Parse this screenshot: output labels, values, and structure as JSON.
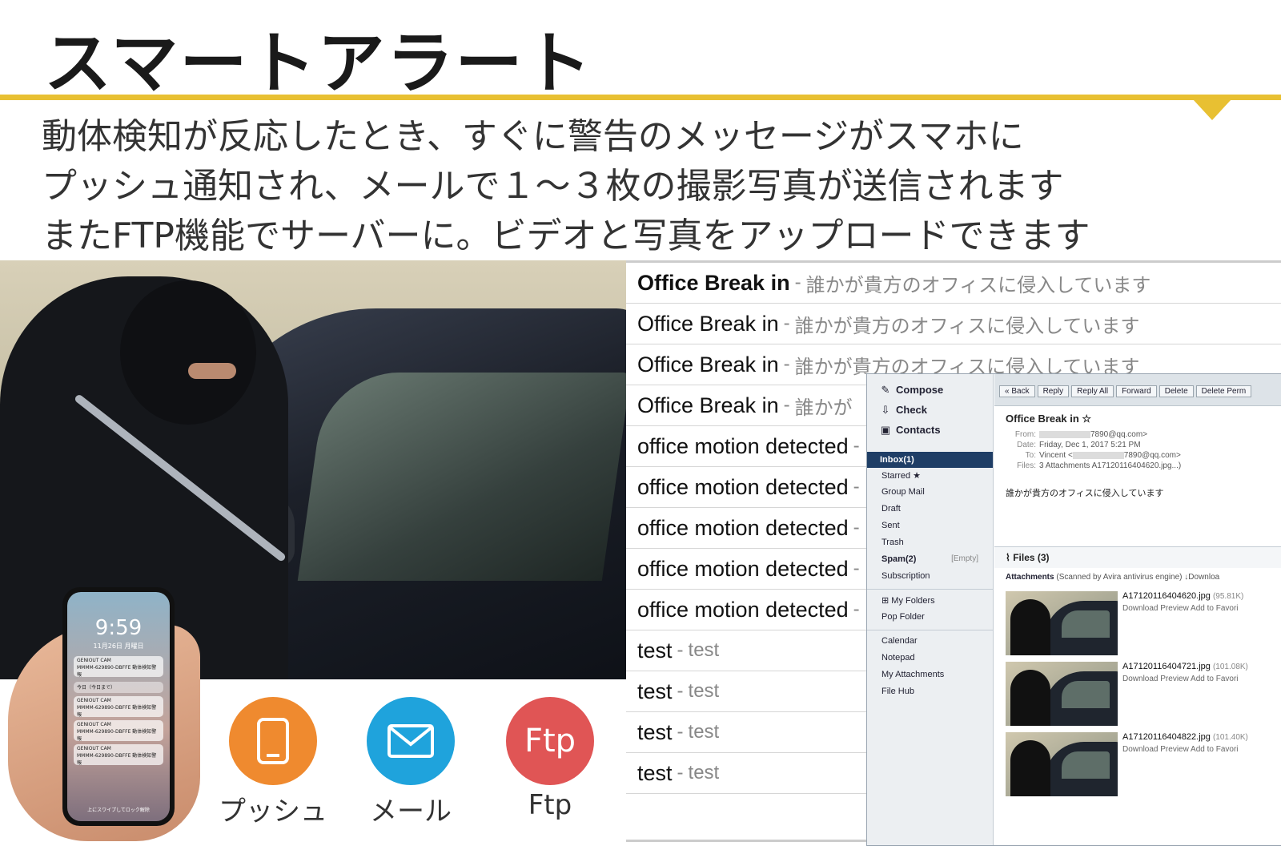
{
  "header": {
    "title": "スマートアラート",
    "subtitle_lines": [
      "動体検知が反応したとき、すぐに警告のメッセージがスマホに",
      "プッシュ通知され、メールで１～３枚の撮影写真が送信されます",
      "またFTP機能でサーバーに。ビデオと写真をアップロードできます"
    ]
  },
  "phone": {
    "time": "9:59",
    "date": "11月26日 月曜日",
    "notifications": [
      {
        "app": "GENIOUT CAM",
        "text": "MMMM-629890-DBFFE 動体検知警報"
      },
      {
        "app": "今日（今日まで）",
        "text": ""
      },
      {
        "app": "GENIOUT CAM",
        "text": "MMMM-629890-DBFFE 動体検知警報"
      },
      {
        "app": "GENIOUT CAM",
        "text": "MMMM-629890-DBFFE 動体検知警報"
      },
      {
        "app": "GENIOUT CAM",
        "text": "MMMM-629890-DBFFE 動体検知警報"
      }
    ],
    "unlock_hint": "上にスワイプしてロック解除"
  },
  "features": [
    {
      "label": "プッシュ",
      "icon": "tablet-icon",
      "color": "#ef8a2f"
    },
    {
      "label": "メール",
      "icon": "envelope-icon",
      "color": "#1fa3dc"
    },
    {
      "label": "Ftp",
      "icon_text": "Ftp",
      "icon": "ftp-icon",
      "color": "#e05555"
    }
  ],
  "mail_list": [
    {
      "subject": "Office Break in",
      "preview": "誰かが貴方のオフィスに侵入しています",
      "bold": true
    },
    {
      "subject": "Office Break in",
      "preview": "誰かが貴方のオフィスに侵入しています",
      "bold": false
    },
    {
      "subject": "Office Break in",
      "preview": "誰かが貴方のオフィスに侵入しています",
      "bold": false
    },
    {
      "subject": "Office Break in",
      "preview": "誰かが",
      "bold": false
    },
    {
      "subject": "office motion detected",
      "preview": "",
      "bold": false
    },
    {
      "subject": "office motion detected",
      "preview": "",
      "bold": false
    },
    {
      "subject": "office motion detected",
      "preview": "",
      "bold": false
    },
    {
      "subject": "office motion detected",
      "preview": "",
      "bold": false
    },
    {
      "subject": "office motion detected",
      "preview": "",
      "bold": false
    },
    {
      "subject": "test",
      "preview": "test",
      "bold": false
    },
    {
      "subject": "test",
      "preview": "test",
      "bold": false
    },
    {
      "subject": "test",
      "preview": "test",
      "bold": false
    },
    {
      "subject": "test",
      "preview": "test",
      "bold": false
    }
  ],
  "client": {
    "actions": [
      {
        "label": "Compose",
        "icon": "pencil-icon"
      },
      {
        "label": "Check",
        "icon": "inbox-icon"
      },
      {
        "label": "Contacts",
        "icon": "contacts-icon"
      }
    ],
    "inbox": "Inbox(1)",
    "folders": [
      "Starred ★",
      "Group Mail",
      "Draft",
      "Sent",
      "Trash",
      "Spam(2)",
      "Subscription"
    ],
    "spam_empty": "[Empty]",
    "my_folders": "My Folders",
    "pop_folder": "Pop Folder",
    "tools": [
      "Calendar",
      "Notepad",
      "My Attachments",
      "File Hub"
    ],
    "toolbar": [
      "« Back",
      "Reply",
      "Reply All",
      "Forward",
      "Delete",
      "Delete Perm"
    ],
    "message": {
      "subject": "Office Break in ☆",
      "from_label": "From:",
      "from": "7890@qq.com>",
      "date_label": "Date:",
      "date": "Friday, Dec 1, 2017 5:21 PM",
      "to_label": "To:",
      "to_name": "Vincent <",
      "to": "7890@qq.com>",
      "files_label": "Files:",
      "files": "3 Attachments",
      "files_name": "A17120116404620.jpg...)",
      "body": "誰かが貴方のオフィスに侵入しています"
    },
    "files_header": "Files (3)",
    "attachments_label": "Attachments",
    "scan_note": "(Scanned by Avira antivirus engine)",
    "download_all": "↓Downloa",
    "attachments": [
      {
        "name": "A17120116404620.jpg",
        "size": "(95.81K)"
      },
      {
        "name": "A17120116404721.jpg",
        "size": "(101.08K)"
      },
      {
        "name": "A17120116404822.jpg",
        "size": "(101.40K)"
      }
    ],
    "attachment_actions": "Download   Preview   Add to Favori"
  }
}
